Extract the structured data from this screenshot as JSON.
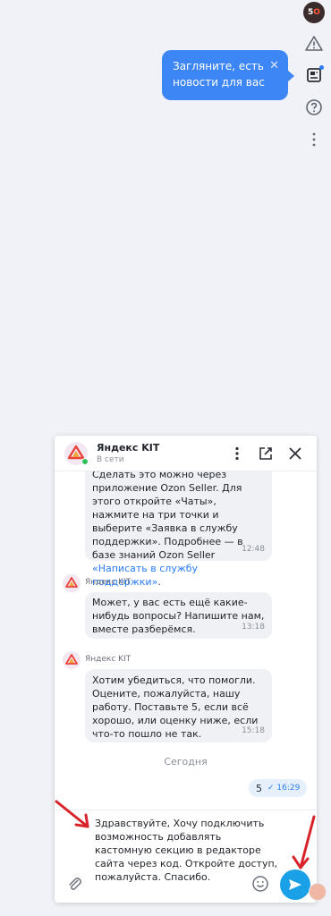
{
  "rail": {
    "avatar_text": "5",
    "avatar_accent": "O",
    "icons": [
      "alert-icon",
      "news-icon",
      "help-icon",
      "more-vertical-icon"
    ]
  },
  "tooltip": {
    "text": "Загляните, есть новости для вас",
    "close": "✕"
  },
  "chat": {
    "title": "Яндекс KIT",
    "status": "В сети",
    "messages": [
      {
        "text": "Сделать это можно через приложение Ozon Seller. Для этого откройте «Чаты», нажмите на три точки и выберите «Заявка в службу поддержки». Подробнее — в базе знаний Ozon Seller ",
        "link": "«Написать в службу поддержки»",
        "tail": ".",
        "time": "12:48"
      },
      {
        "sender": "Яндекс KIT",
        "text": "Может, у вас есть ещё какие-нибудь вопросы? Напишите нам, вместе разберёмся.",
        "time": "13:18"
      },
      {
        "sender": "Яндекс KIT",
        "text": "Хотим убедиться, что помогли. Оцените, пожалуйста, нашу работу. Поставьте 5, если всё хорошо, или оценку ниже, если что-то пошло не так.",
        "time": "15:18"
      }
    ],
    "date_separator": "Сегодня",
    "my_message": {
      "text": "5",
      "check": "✓",
      "time": "16:29"
    },
    "composer": {
      "value": "Здравствуйте, Хочу подключить возможность добавлять кастомную секцию в редакторе сайта через код. Откройте доступ, пожалуйста. Спасибо."
    }
  },
  "colors": {
    "accent": "#3d86f5",
    "send": "#1aa0e6",
    "annotation": "#d9232a"
  }
}
